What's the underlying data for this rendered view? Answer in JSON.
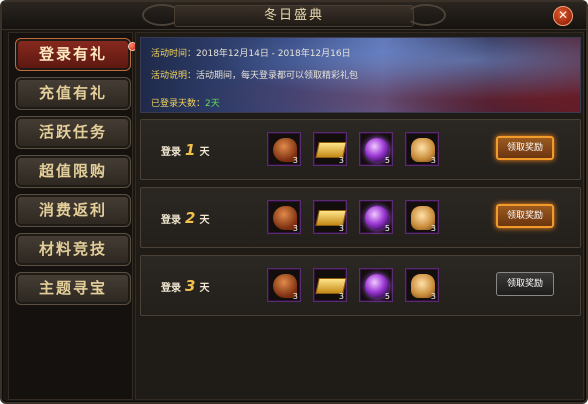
{
  "window": {
    "title": "冬日盛典",
    "close_glyph": "✕"
  },
  "sidebar": {
    "items": [
      {
        "label": "登录有礼",
        "active": true,
        "badge": true
      },
      {
        "label": "充值有礼",
        "active": false
      },
      {
        "label": "活跃任务",
        "active": false
      },
      {
        "label": "超值限购",
        "active": false
      },
      {
        "label": "消费返利",
        "active": false
      },
      {
        "label": "材料竞技",
        "active": false
      },
      {
        "label": "主题寻宝",
        "active": false
      }
    ]
  },
  "banner": {
    "time_label": "活动时间：",
    "time_value": "2018年12月14日 - 2018年12月16日",
    "desc_label": "活动说明：",
    "desc_value": "活动期间，每天登录都可以领取精彩礼包",
    "days_label": "已登录天数：",
    "days_value": "2天"
  },
  "rows": [
    {
      "prefix": "登录",
      "day": "1",
      "suffix": "天",
      "button": "领取奖励",
      "button_state": "on"
    },
    {
      "prefix": "登录",
      "day": "2",
      "suffix": "天",
      "button": "领取奖励",
      "button_state": "on"
    },
    {
      "prefix": "登录",
      "day": "3",
      "suffix": "天",
      "button": "领取奖励",
      "button_state": "off"
    }
  ],
  "items": [
    {
      "icon": "boot-icon",
      "qty": "3"
    },
    {
      "icon": "gold-bar-icon",
      "qty": "3"
    },
    {
      "icon": "purple-orb-icon",
      "qty": "5"
    },
    {
      "icon": "gift-bag-icon",
      "qty": "3"
    }
  ],
  "colors": {
    "accent_gold": "#f2c14b",
    "active_tab": "#8a2a1f",
    "days_green": "#62e060"
  }
}
